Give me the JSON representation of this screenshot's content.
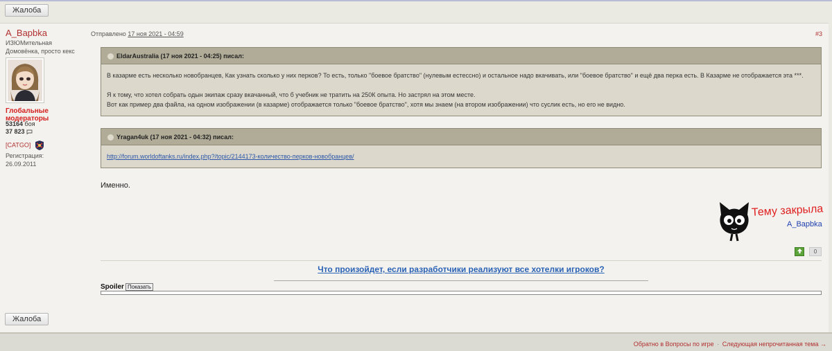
{
  "report_button_label": "Жалоба",
  "user": {
    "name": "A_Bapbka",
    "title": "ИЗЮМительная Домовёнка, просто кекс",
    "group": "Глобальные модераторы",
    "battles_value": "53164",
    "battles_label": "боя",
    "posts_value": "37 823",
    "clan": "[CATGO]",
    "registration_label": "Регистрация:",
    "registration_date": "26.09.2011"
  },
  "post": {
    "posted_label": "Отправлено",
    "posted_date": "17 ноя 2021 - 04:59",
    "number": "#3",
    "quotes": [
      {
        "header": "EldarAustralia (17 ноя 2021 - 04:25) писал:",
        "paragraphs": [
          "В казарме есть несколько новобранцев, Как узнать сколько у них перков? То есть, только \"боевое братство\" (нулевым естессно)  и остальное надо вкачивать, или \"боевое братство\" и ещё два перка есть. В Казарме не отображается эта ***.",
          "Я к тому, что хотел собрать одын экипаж сразу вкачанный, что б учебник не тратить на 250К опыта. Но застрял на этом месте.",
          "Вот как пример два файла, на одном изображении (в казарме) отображается только \"боевое братство\", хотя мы знаем (на втором изображении) что суслик есть, но его не видно."
        ]
      },
      {
        "header": "Yragan4uk (17 ноя 2021 - 04:32) писал:",
        "link": "http://forum.worldoftanks.ru/index.php?/topic/2144173-количество-перков-новобранцев/"
      }
    ],
    "text": "Именно.",
    "signature_image_title": "Тему закрыла",
    "signature_image_name": "A_Bapbka",
    "votes": "0",
    "signature_link": "Что произойдет, если разработчики реализуют все хотелки игроков?",
    "spoiler_label": "Spoiler",
    "spoiler_button": "Показать"
  },
  "footer": {
    "back_link": "Обратно в Вопросы по игре",
    "separator": "·",
    "next_link": "Следующая непрочитанная тема →"
  },
  "colors": {
    "accent_red": "#b03030",
    "moderator_red": "#d42020",
    "link_blue": "#2a62b5",
    "vote_green": "#5ca33a"
  }
}
